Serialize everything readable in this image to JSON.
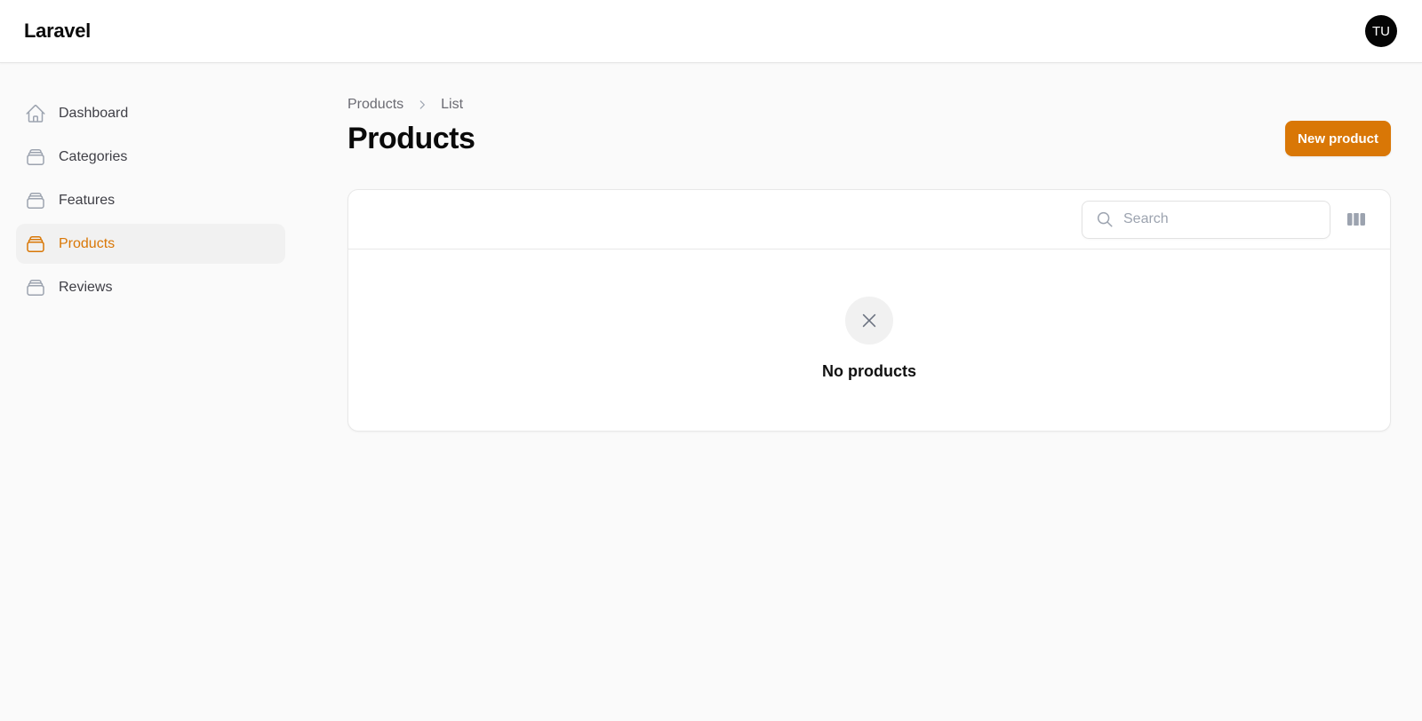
{
  "app": {
    "brand": "Laravel",
    "user_initials": "TU"
  },
  "sidebar": {
    "items": [
      {
        "label": "Dashboard",
        "icon": "home-icon",
        "active": false
      },
      {
        "label": "Categories",
        "icon": "rectangle-stack-icon",
        "active": false
      },
      {
        "label": "Features",
        "icon": "rectangle-stack-icon",
        "active": false
      },
      {
        "label": "Products",
        "icon": "rectangle-stack-icon",
        "active": true
      },
      {
        "label": "Reviews",
        "icon": "rectangle-stack-icon",
        "active": false
      }
    ]
  },
  "breadcrumb": {
    "items": [
      "Products",
      "List"
    ],
    "separator_icon": "chevron-right-icon"
  },
  "page": {
    "title": "Products",
    "new_button_label": "New product"
  },
  "table": {
    "search_placeholder": "Search",
    "search_value": "",
    "columns_toggle_icon": "view-columns-icon",
    "empty_icon": "x-mark-icon",
    "empty_title": "No products"
  },
  "colors": {
    "accent": "#d97706",
    "background": "#fafafa",
    "surface": "#ffffff",
    "active_nav_bg": "#f1f1f1",
    "avatar_bg": "#050505"
  }
}
